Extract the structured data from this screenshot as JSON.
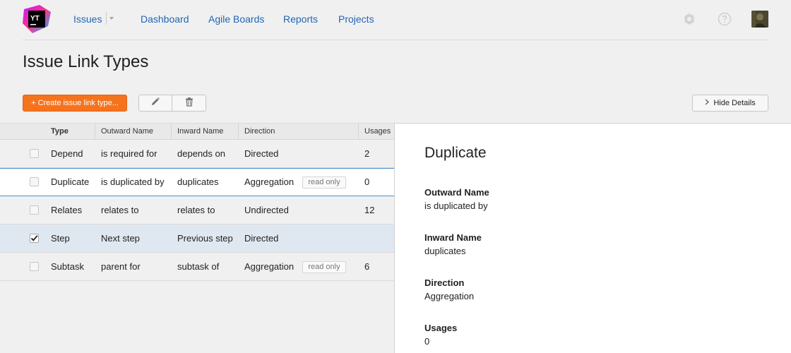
{
  "nav": {
    "issues": "Issues",
    "dashboard": "Dashboard",
    "agile_boards": "Agile Boards",
    "reports": "Reports",
    "projects": "Projects",
    "logo_text": "YT"
  },
  "page": {
    "title": "Issue Link Types"
  },
  "toolbar": {
    "create_label": "+ Create issue link type...",
    "hide_details_label": "Hide Details"
  },
  "table": {
    "headers": [
      "Type",
      "Outward Name",
      "Inward Name",
      "Direction",
      "Usages"
    ],
    "rows": [
      {
        "type": "Depend",
        "outward": "is required for",
        "inward": "depends on",
        "direction": "Directed",
        "usages": "2",
        "read_only": "",
        "checked": false
      },
      {
        "type": "Duplicate",
        "outward": "is duplicated by",
        "inward": "duplicates",
        "direction": "Aggregation",
        "usages": "0",
        "read_only": "read only",
        "checked": false
      },
      {
        "type": "Relates",
        "outward": "relates to",
        "inward": "relates to",
        "direction": "Undirected",
        "usages": "12",
        "read_only": "",
        "checked": false
      },
      {
        "type": "Step",
        "outward": "Next step",
        "inward": "Previous step",
        "direction": "Directed",
        "usages": "",
        "read_only": "",
        "checked": true
      },
      {
        "type": "Subtask",
        "outward": "parent for",
        "inward": "subtask of",
        "direction": "Aggregation",
        "usages": "6",
        "read_only": "read only",
        "checked": false
      }
    ]
  },
  "details": {
    "title": "Duplicate",
    "outward_label": "Outward Name",
    "outward_value": "is duplicated by",
    "inward_label": "Inward Name",
    "inward_value": "duplicates",
    "direction_label": "Direction",
    "direction_value": "Aggregation",
    "usages_label": "Usages",
    "usages_value": "0"
  },
  "colors": {
    "accent": "#f5731d",
    "link": "#1f66b5",
    "selection": "#dfe8f1",
    "selection_border": "#4a8fcf"
  },
  "icons": {
    "edit": "pencil-icon",
    "delete": "trash-icon",
    "settings": "gear-icon",
    "help": "help-icon"
  }
}
